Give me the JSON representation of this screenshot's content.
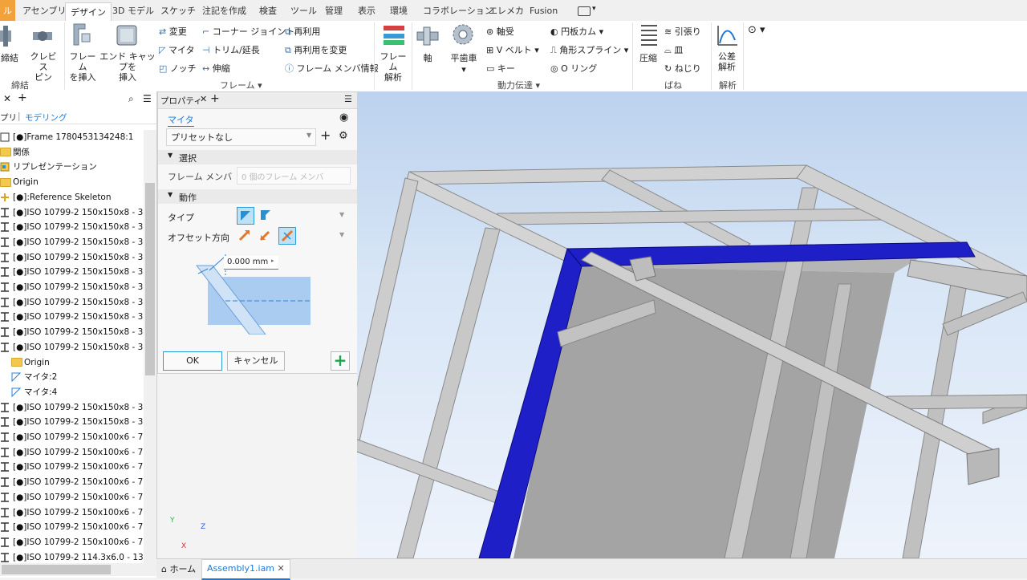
{
  "tabs": [
    "ル",
    "アセンブリ",
    "デザイン",
    "3D モデル",
    "スケッチ",
    "注記を作成",
    "検査",
    "ツール",
    "管理",
    "表示",
    "環境",
    "コラボレーション",
    "エレメカ",
    "Fusion"
  ],
  "ribbon": {
    "fasten": {
      "bind": "締結",
      "clevis": "クレビス\nピン",
      "group": "締結"
    },
    "frame": {
      "insert_frame": "フレーム\nを挿入",
      "end_cap": "エンド キャップを\n挿入",
      "change": "変更",
      "miter": "マイタ",
      "notch": "ノッチ",
      "corner_joint": "コーナー ジョイント",
      "trim_extend": "トリム/延長",
      "lengthen": "伸縮",
      "reuse": "再利用",
      "change_reuse": "再利用を変更",
      "frame_member_info": "フレーム メンバ情報",
      "group": "フレーム"
    },
    "frame_analysis": {
      "label": "フレーム\n解析"
    },
    "power": {
      "shaft": "軸",
      "spur_gear": "平歯車",
      "bearing": "軸受",
      "vbelt": "V ベルト",
      "key": "キー",
      "cam": "円板カム",
      "spline": "角形スプライン",
      "oring": "O リング",
      "group": "動力伝達"
    },
    "spring": {
      "compression": "圧縮",
      "tension": "引張り",
      "disc": "皿",
      "torsion": "ねじり",
      "group": "ばね"
    },
    "analysis": {
      "tolerance": "公差\n解析",
      "group": "解析"
    }
  },
  "browser": {
    "tabs": [
      "プリ",
      "モデリング"
    ],
    "rows": [
      {
        "icon": "asm",
        "text": "[●]Frame 1780453134248:1"
      },
      {
        "icon": "folder",
        "text": "関係"
      },
      {
        "icon": "rep",
        "text": "リプレゼンテーション"
      },
      {
        "icon": "folder",
        "text": "Origin"
      },
      {
        "icon": "skel",
        "text": "[●]:Reference Skeleton"
      },
      {
        "icon": "beam",
        "text": "[●]ISO 10799-2 150x150x8 - 3"
      },
      {
        "icon": "beam",
        "text": "[●]ISO 10799-2 150x150x8 - 3"
      },
      {
        "icon": "beam",
        "text": "[●]ISO 10799-2 150x150x8 - 3"
      },
      {
        "icon": "beam",
        "text": "[●]ISO 10799-2 150x150x8 - 3"
      },
      {
        "icon": "beam",
        "text": "[●]ISO 10799-2 150x150x8 - 3"
      },
      {
        "icon": "beam",
        "text": "[●]ISO 10799-2 150x150x8 - 3"
      },
      {
        "icon": "beam",
        "text": "[●]ISO 10799-2 150x150x8 - 3"
      },
      {
        "icon": "beam",
        "text": "[●]ISO 10799-2 150x150x8 - 3"
      },
      {
        "icon": "beam",
        "text": "[●]ISO 10799-2 150x150x8 - 3"
      },
      {
        "icon": "beam",
        "text": "[●]ISO 10799-2 150x150x8 - 3"
      },
      {
        "icon": "folder",
        "text": "Origin",
        "indent": true
      },
      {
        "icon": "miter",
        "text": "マイタ:2",
        "indent": true
      },
      {
        "icon": "miter",
        "text": "マイタ:4",
        "indent": true
      },
      {
        "icon": "beam",
        "text": "[●]ISO 10799-2 150x150x8 - 3"
      },
      {
        "icon": "beam",
        "text": "[●]ISO 10799-2 150x150x8 - 3"
      },
      {
        "icon": "beam",
        "text": "[●]ISO 10799-2 150x100x6 - 7"
      },
      {
        "icon": "beam",
        "text": "[●]ISO 10799-2 150x100x6 - 7"
      },
      {
        "icon": "beam",
        "text": "[●]ISO 10799-2 150x100x6 - 7"
      },
      {
        "icon": "beam",
        "text": "[●]ISO 10799-2 150x100x6 - 7"
      },
      {
        "icon": "beam",
        "text": "[●]ISO 10799-2 150x100x6 - 7"
      },
      {
        "icon": "beam",
        "text": "[●]ISO 10799-2 150x100x6 - 7"
      },
      {
        "icon": "beam",
        "text": "[●]ISO 10799-2 150x100x6 - 7"
      },
      {
        "icon": "beam",
        "text": "[●]ISO 10799-2 150x100x6 - 7"
      },
      {
        "icon": "beam",
        "text": "[●]ISO 10799-2 114.3x6.0 - 13"
      }
    ]
  },
  "props": {
    "tab": "プロパティ",
    "command": "マイタ",
    "preset": "プリセットなし",
    "section_select": "選択",
    "frame_member": "フレーム メンバ",
    "frame_member_placeholder": "0 個のフレーム メンバ",
    "section_behavior": "動作",
    "type": "タイプ",
    "offset_dir": "オフセット方向",
    "offset_value": "0.000 mm",
    "ok": "OK",
    "cancel": "キャンセル"
  },
  "bottom_tabs": {
    "home": "ホーム",
    "doc": "Assembly1.iam"
  },
  "triad": {
    "x": "X",
    "y": "Y",
    "z": "Z"
  },
  "colors": {
    "selected": "#1f1fc8",
    "accent": "#1e78d6",
    "highlight": "#2a9fd6"
  }
}
